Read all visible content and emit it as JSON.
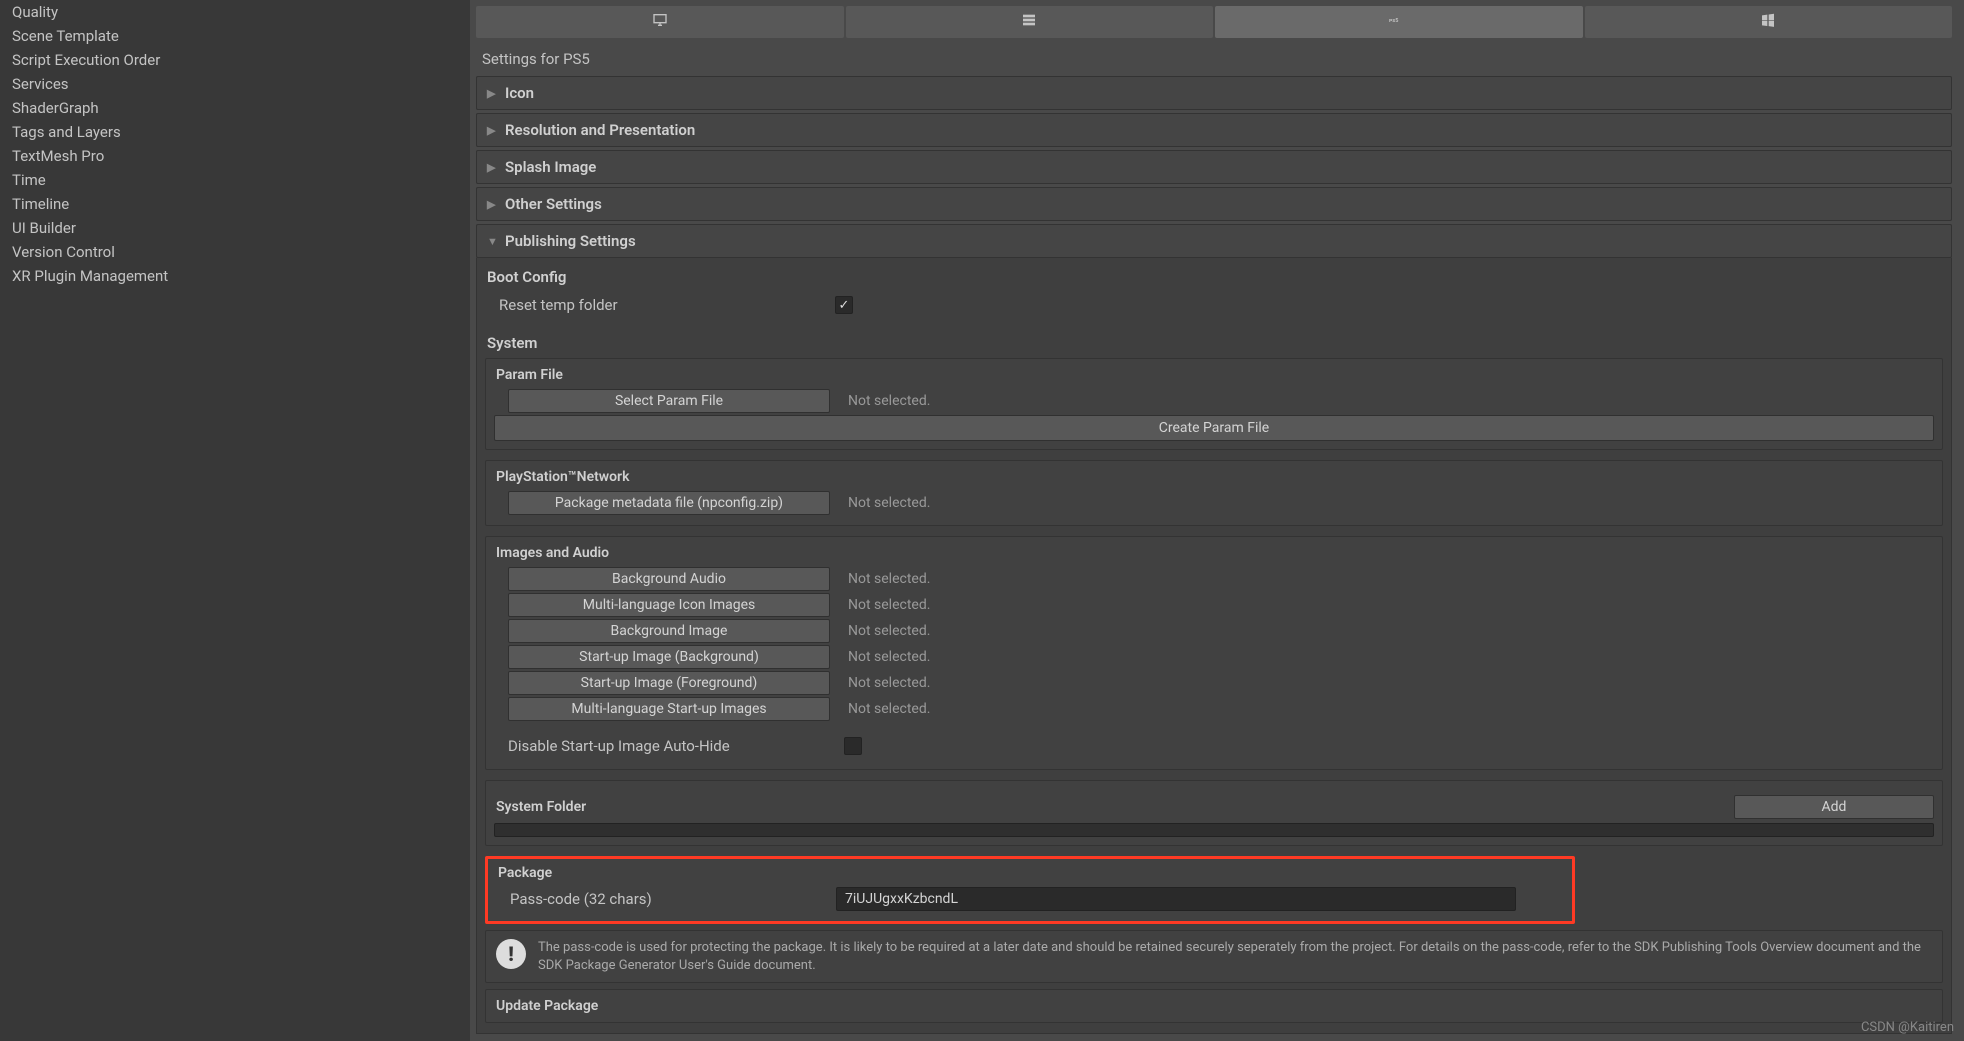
{
  "sidebar": {
    "items": [
      "Quality",
      "Scene Template",
      "Script Execution Order",
      "Services",
      "ShaderGraph",
      "Tags and Layers",
      "TextMesh Pro",
      "Time",
      "Timeline",
      "UI Builder",
      "Version Control",
      "XR Plugin Management"
    ]
  },
  "main": {
    "settings_title": "Settings for PS5",
    "sections": {
      "icon": "Icon",
      "resolution": "Resolution and Presentation",
      "splash": "Splash Image",
      "other": "Other Settings",
      "publishing": "Publishing Settings",
      "update_package": "Update Package"
    },
    "publishing": {
      "boot_config": {
        "heading": "Boot Config",
        "reset_temp_folder": "Reset temp folder",
        "reset_checked": true
      },
      "system": {
        "heading": "System",
        "param_file": {
          "group_label": "Param File",
          "select_btn": "Select Param File",
          "select_status": "Not selected.",
          "create_btn": "Create Param File"
        },
        "psn": {
          "group_label": "PlayStation™Network",
          "metadata_btn": "Package metadata file (npconfig.zip)",
          "metadata_status": "Not selected."
        },
        "images_audio": {
          "group_label": "Images and Audio",
          "rows": [
            {
              "btn": "Background Audio",
              "status": "Not selected."
            },
            {
              "btn": "Multi-language Icon Images",
              "status": "Not selected."
            },
            {
              "btn": "Background Image",
              "status": "Not selected."
            },
            {
              "btn": "Start-up Image (Background)",
              "status": "Not selected."
            },
            {
              "btn": "Start-up Image (Foreground)",
              "status": "Not selected."
            },
            {
              "btn": "Multi-language Start-up Images",
              "status": "Not selected."
            }
          ],
          "disable_auto_hide": "Disable Start-up Image Auto-Hide"
        },
        "system_folder": {
          "label": "System Folder",
          "add_btn": "Add"
        }
      },
      "package": {
        "heading": "Package",
        "passcode_label": "Pass-code (32 chars)",
        "passcode_value": "7iUJUgxxKzbcndL",
        "info_text": "The pass-code is used for protecting the package. It is likely to be required at a later date and should be retained securely seperately from the project. For details on the pass-code, refer to the SDK Publishing Tools Overview document and the SDK Package Generator User's Guide document."
      }
    }
  },
  "watermark": "CSDN @Kaitiren"
}
